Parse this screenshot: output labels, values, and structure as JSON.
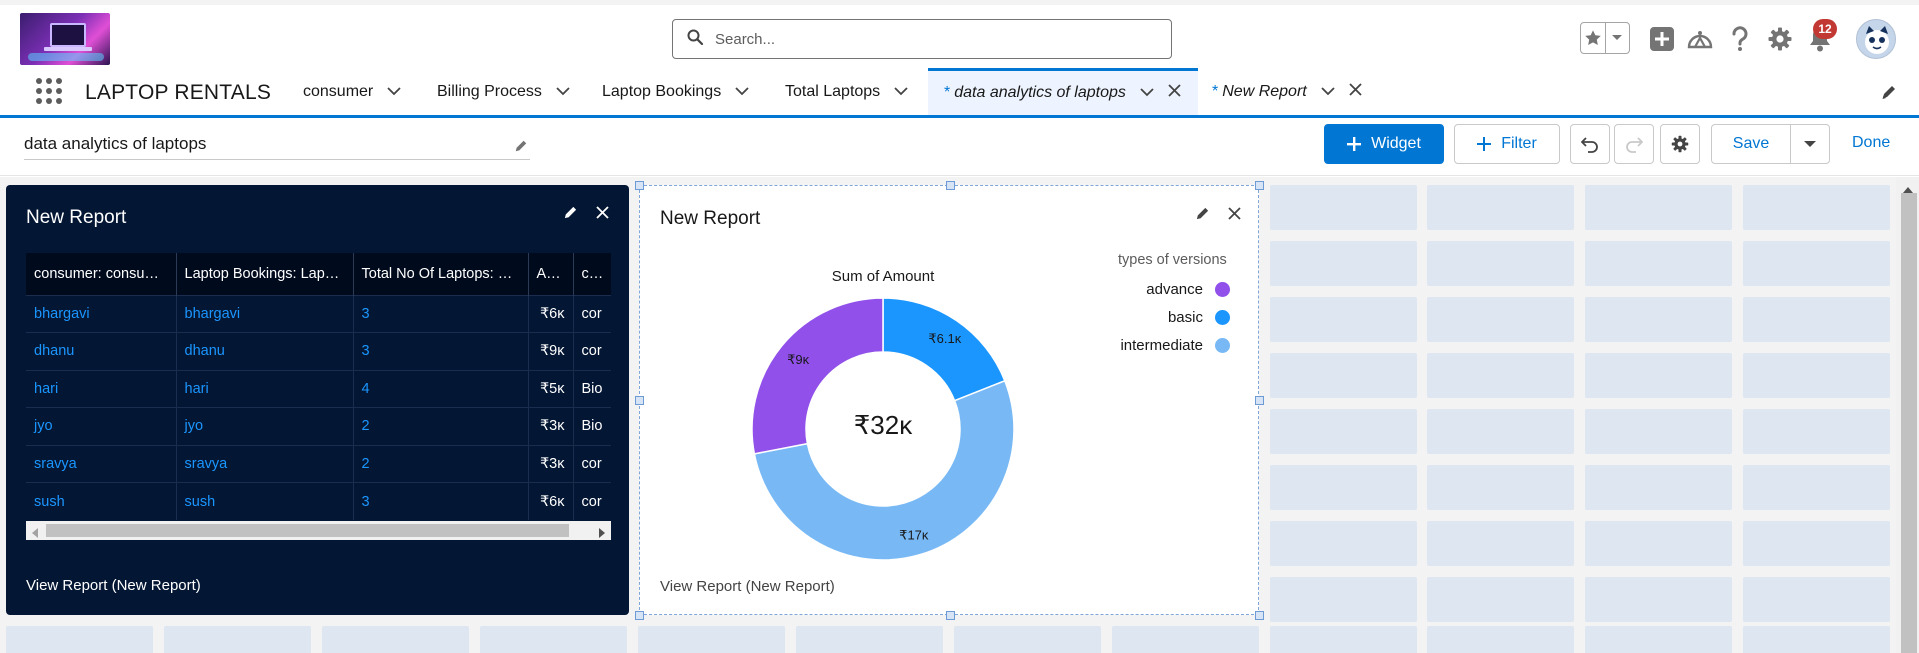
{
  "header": {
    "search_placeholder": "Search...",
    "notification_count": "12"
  },
  "nav": {
    "app_name": "LAPTOP RENTALS",
    "tabs": [
      {
        "label": "consumer"
      },
      {
        "label": "Billing Process"
      },
      {
        "label": "Laptop Bookings"
      },
      {
        "label": "Total Laptops"
      },
      {
        "label": "data analytics of laptops",
        "prefix": "*"
      },
      {
        "label": "New Report",
        "prefix": "*"
      }
    ]
  },
  "dashboard": {
    "title": "data analytics of laptops",
    "widget_label": "Widget",
    "filter_label": "Filter",
    "save_label": "Save",
    "done_label": "Done"
  },
  "table_widget": {
    "title": "New Report",
    "columns": [
      "consumer: consu…",
      "Laptop Bookings: Lap…",
      "Total No Of Laptops: …",
      "A…",
      "co…"
    ],
    "rows": [
      [
        "bhargavi",
        "bhargavi",
        "3",
        "₹6ĸ",
        "cor"
      ],
      [
        "dhanu",
        "dhanu",
        "3",
        "₹9ĸ",
        "cor"
      ],
      [
        "hari",
        "hari",
        "4",
        "₹5ĸ",
        "Bio"
      ],
      [
        "jyo",
        "jyo",
        "2",
        "₹3ĸ",
        "Bio"
      ],
      [
        "sravya",
        "sravya",
        "2",
        "₹3ĸ",
        "cor"
      ],
      [
        "sush",
        "sush",
        "3",
        "₹6ĸ",
        "cor"
      ]
    ],
    "footer": "View Report (New Report)"
  },
  "chart_widget": {
    "title": "New Report",
    "footer": "View Report (New Report)",
    "chart_data": {
      "type": "pie",
      "title": "Sum of Amount",
      "center_label": "₹32ĸ",
      "legend_title": "types of versions",
      "legend_position": "top-right",
      "slices": [
        {
          "name": "advance",
          "value": 9,
          "label": "₹9ĸ",
          "color": "#9050e9"
        },
        {
          "name": "basic",
          "value": 6.1,
          "label": "₹6.1ĸ",
          "color": "#1b96ff"
        },
        {
          "name": "intermediate",
          "value": 17,
          "label": "₹17ĸ",
          "color": "#78b9f5"
        }
      ]
    }
  },
  "colors": {
    "brand": "#0176d3",
    "dark_panel": "#031633",
    "canvas": "#f3f3f3",
    "ghost_cell": "#dde6f1",
    "badge": "#c23934"
  }
}
